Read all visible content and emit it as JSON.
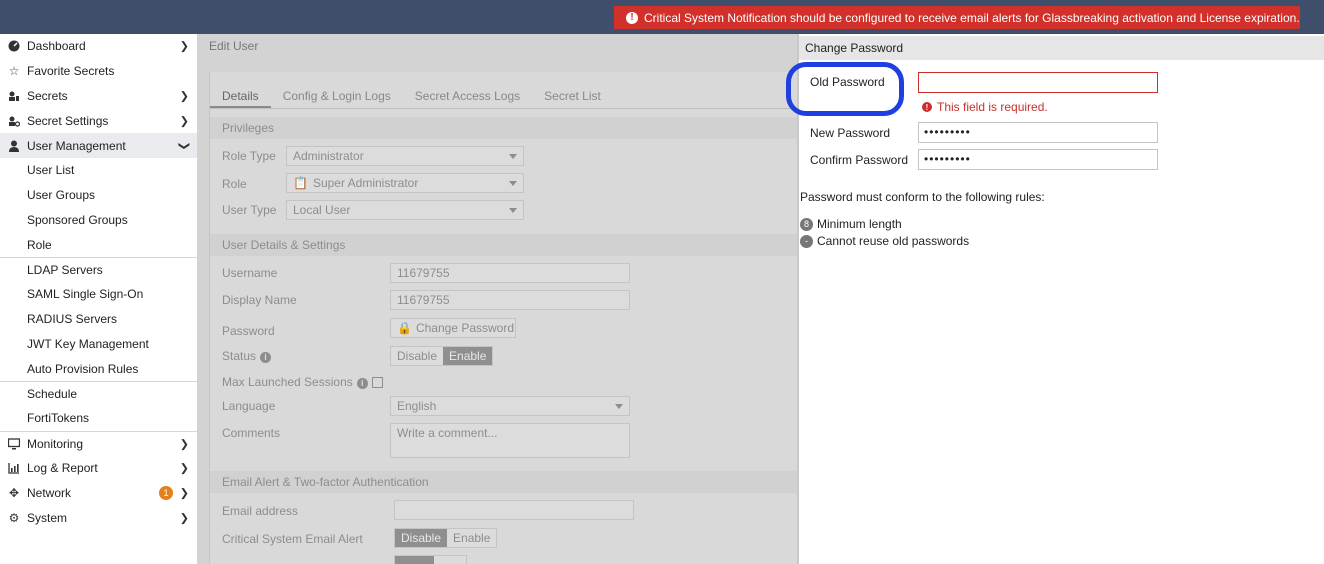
{
  "notification": {
    "text": "Critical System Notification should be configured to receive email alerts for Glassbreaking activation and License expiration.",
    "color": "#d2302b"
  },
  "sidebar": {
    "items": [
      {
        "label": "Dashboard",
        "icon": "dashboard-icon",
        "chevron": "right"
      },
      {
        "label": "Favorite Secrets",
        "icon": "star-icon"
      },
      {
        "label": "Secrets",
        "icon": "secrets-icon",
        "chevron": "right"
      },
      {
        "label": "Secret Settings",
        "icon": "secret-settings-icon",
        "chevron": "right"
      },
      {
        "label": "User Management",
        "icon": "user-icon",
        "chevron": "down"
      },
      {
        "label": "Monitoring",
        "icon": "monitor-icon",
        "chevron": "right"
      },
      {
        "label": "Log & Report",
        "icon": "chart-icon",
        "chevron": "right"
      },
      {
        "label": "Network",
        "icon": "network-icon",
        "chevron": "right",
        "badge": "1"
      },
      {
        "label": "System",
        "icon": "gear-icon",
        "chevron": "right"
      }
    ],
    "sub": [
      "User List",
      "User Groups",
      "Sponsored Groups",
      "Role",
      "LDAP Servers",
      "SAML Single Sign-On",
      "RADIUS Servers",
      "JWT Key Management",
      "Auto Provision Rules",
      "Schedule",
      "FortiTokens"
    ]
  },
  "main": {
    "crumb": "Edit User",
    "tabs": [
      "Details",
      "Config & Login Logs",
      "Secret Access Logs",
      "Secret List"
    ],
    "privileges": {
      "heading": "Privileges",
      "role_type_label": "Role Type",
      "role_type_value": "Administrator",
      "role_label": "Role",
      "role_value": "Super Administrator",
      "user_type_label": "User Type",
      "user_type_value": "Local User"
    },
    "details": {
      "heading": "User Details & Settings",
      "username_label": "Username",
      "username_value": "11679755",
      "display_label": "Display Name",
      "display_value": "11679755",
      "password_label": "Password",
      "change_password": "Change Password",
      "status_label": "Status",
      "disable": "Disable",
      "enable": "Enable",
      "max_sessions_label": "Max Launched Sessions",
      "language_label": "Language",
      "language_value": "English",
      "comments_label": "Comments",
      "comments_placeholder": "Write a comment..."
    },
    "email": {
      "heading": "Email Alert & Two-factor Authentication",
      "email_label": "Email address",
      "critical_label": "Critical System Email Alert",
      "disable": "Disable",
      "enable": "Enable"
    }
  },
  "panel": {
    "title": "Change Password",
    "old_label": "Old Password",
    "old_value": "",
    "error": "This field is required.",
    "new_label": "New Password",
    "new_value": "•••••••••",
    "confirm_label": "Confirm Password",
    "confirm_value": "•••••••••",
    "rules_heading": "Password must conform to the following rules:",
    "rules": [
      {
        "badge": "8",
        "text": "Minimum length"
      },
      {
        "badge": "-",
        "text": "Cannot reuse old passwords"
      }
    ]
  }
}
